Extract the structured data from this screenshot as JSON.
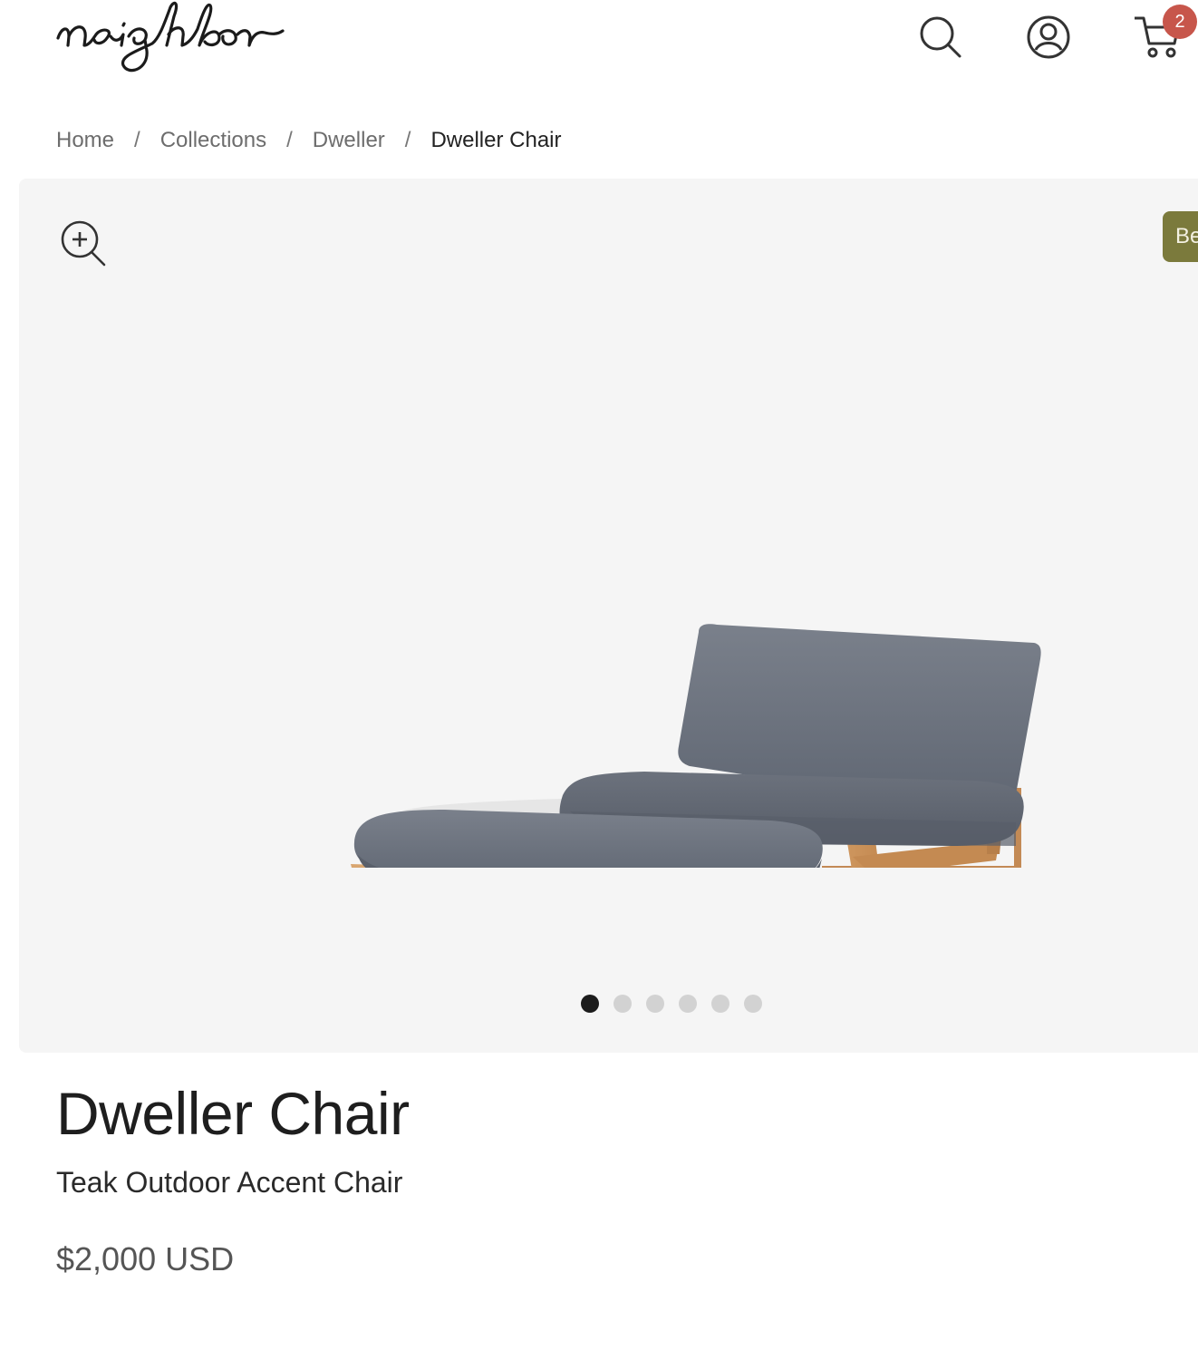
{
  "header": {
    "logo_text": "neighbor",
    "cart_count": "2",
    "icons": [
      "search-icon",
      "account-icon",
      "cart-icon"
    ]
  },
  "breadcrumb": {
    "items": [
      "Home",
      "Collections",
      "Dweller"
    ],
    "current": "Dweller Chair",
    "separator": "/"
  },
  "gallery": {
    "badge_text": "Be",
    "slide_count": 6,
    "active_slide": 1,
    "zoom_icon": "zoom-in-icon"
  },
  "product": {
    "title": "Dweller Chair",
    "subtitle": "Teak Outdoor Accent Chair",
    "price": "$2,000 USD"
  },
  "colors": {
    "badge_red": "#c7564b",
    "promo_olive": "#7b7a3c",
    "gallery_bg": "#f5f5f5"
  }
}
